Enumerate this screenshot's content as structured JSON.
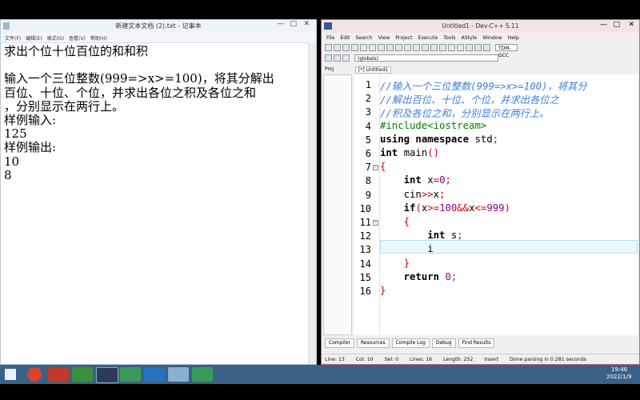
{
  "notepad": {
    "title": "新建文本文档 (2).txt - 记事本",
    "controls": [
      "—",
      "□",
      "✕"
    ],
    "menu": [
      "文件(F)",
      "编辑(E)",
      "格式(O)",
      "查看(V)",
      "帮助(H)"
    ],
    "lines": [
      "求出个位十位百位的和和积",
      "",
      "输入一个三位整数(999=>x>=100)，将其分解出",
      "百位、十位、个位，并求出各位之积及各位之和",
      "，分别显示在两行上。",
      "样例输入:",
      "125",
      "样例输出:",
      "10",
      "8"
    ]
  },
  "devcpp": {
    "title": "Untitled1 - Dev-C++ 5.11",
    "controls": [
      "—",
      "□",
      "✕"
    ],
    "menu": [
      "File",
      "Edit",
      "Search",
      "View",
      "Project",
      "Execute",
      "Tools",
      "AStyle",
      "Window",
      "Help"
    ],
    "compiler_combo": "TDM-GCC",
    "scope_combo": "(globals)",
    "project_tab": "Proj",
    "file_tab": "[*] Untitled1",
    "line_numbers": [
      "1",
      "2",
      "3",
      "4",
      "5",
      "6",
      "7",
      "8",
      "9",
      "10",
      "11",
      "12",
      "13",
      "14",
      "15",
      "16"
    ],
    "bottom_tabs": [
      "Compiler",
      "Resources",
      "Compile Log",
      "Debug",
      "Find Results"
    ],
    "status": {
      "line": "Line:   13",
      "col": "Col:   10",
      "sel": "Sel:   0",
      "lines": "Lines:   16",
      "length": "Length:  252",
      "mode": "Insert",
      "msg": "Done parsing in 0.281 seconds"
    }
  },
  "taskbar": {
    "time": "19:46",
    "date": "2022/1/9",
    "colors": {
      "bar": "#3a6288",
      "accent": "#c0392b"
    }
  }
}
